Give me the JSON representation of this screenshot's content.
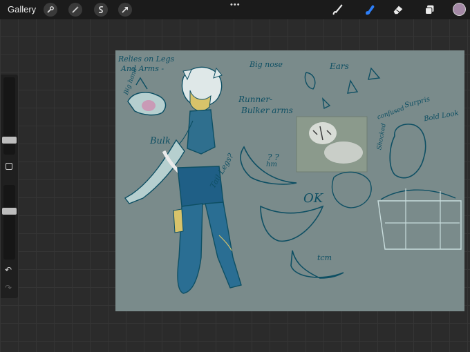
{
  "toolbar": {
    "gallery_label": "Gallery",
    "left_tools": [
      "wrench-icon",
      "magic-wand-icon",
      "selection-icon",
      "transform-arrow-icon"
    ],
    "right_tools": [
      "brush-icon",
      "smudge-icon",
      "eraser-icon",
      "layers-icon"
    ],
    "active_tool": "smudge-icon",
    "active_color": "#a489a6",
    "accent_color": "#2d7ff9",
    "more_label": "•••"
  },
  "sidebar": {
    "brush_size_level": 0.35,
    "opacity_level": 0.35,
    "undo_label": "↶",
    "redo_label": "↷"
  },
  "canvas": {
    "background": "#7a8b8b",
    "annotations": {
      "relies": "Relies on Legs",
      "and_arms": "And Arms -",
      "big_hand": "Big hand",
      "big_nose": "Big nose",
      "runner": "Runner-",
      "bulker_arms": "Bulker arms",
      "bulk": "Bulk",
      "ears": "Ears",
      "tail_legs": "Tail Legs?",
      "question": "? ?",
      "hm": "hm",
      "ok": "OK",
      "confused": "confused",
      "surprised": "Surpris",
      "shocked": "Shocked",
      "bold_look": "Bold Look",
      "tcm": "tcm"
    }
  }
}
